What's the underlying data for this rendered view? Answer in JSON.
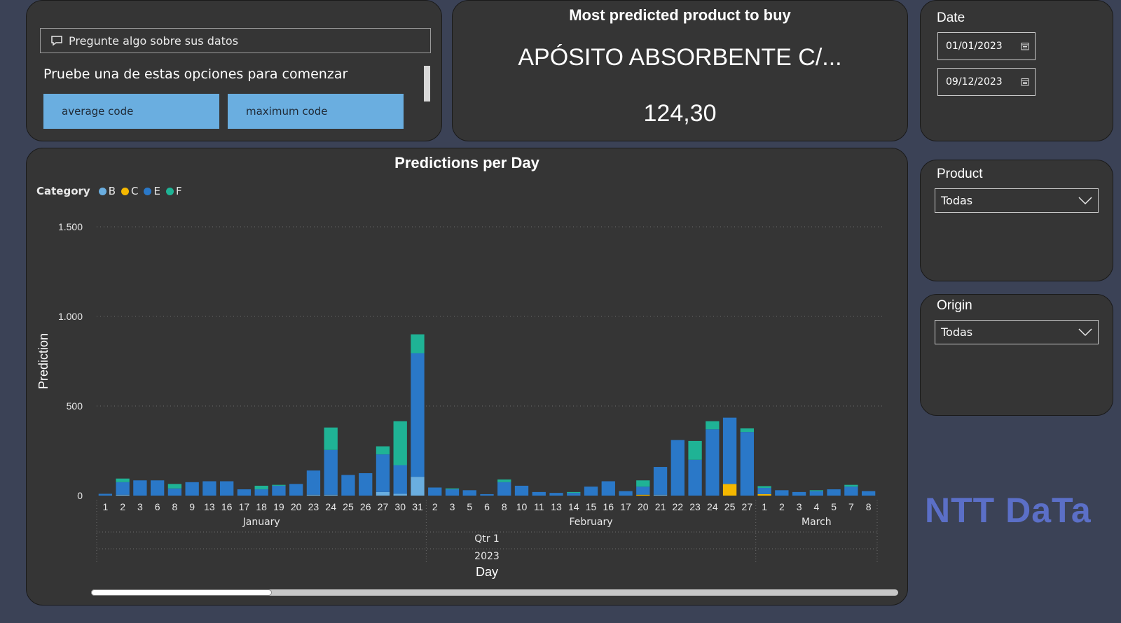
{
  "qa": {
    "placeholder": "Pregunte algo sobre sus datos",
    "prompt": "Pruebe una de estas opciones para comenzar",
    "suggestions": [
      "average code",
      "maximum code"
    ]
  },
  "kpi": {
    "title": "Most predicted product to buy",
    "product": "APÓSITO ABSORBENTE C/...",
    "value": "124,30"
  },
  "date_slicer": {
    "title": "Date",
    "start": "01/01/2023",
    "end": "09/12/2023"
  },
  "product_slicer": {
    "title": "Product",
    "value": "Todas"
  },
  "origin_slicer": {
    "title": "Origin",
    "value": "Todas"
  },
  "logo": {
    "text": "NTT DaTa"
  },
  "colors": {
    "B": "#6aaee0",
    "C": "#f5b800",
    "E": "#2a78c8",
    "F": "#1fb395"
  },
  "chart_data": {
    "type": "bar",
    "stacked": true,
    "title": "Predictions per Day",
    "ylabel": "Prediction",
    "xlabel": "Day",
    "legend_title": "Category",
    "legend_position": "top-left",
    "ylim": [
      0,
      1500
    ],
    "yticks": [
      0,
      500,
      1000,
      1500
    ],
    "ytick_labels": [
      "0",
      "500",
      "1.000",
      "1.500"
    ],
    "grid": true,
    "categories": [
      "1",
      "2",
      "3",
      "6",
      "8",
      "9",
      "13",
      "16",
      "17",
      "18",
      "19",
      "20",
      "23",
      "24",
      "25",
      "26",
      "27",
      "30",
      "31",
      "2",
      "3",
      "5",
      "6",
      "8",
      "10",
      "11",
      "13",
      "14",
      "15",
      "16",
      "17",
      "20",
      "21",
      "22",
      "23",
      "24",
      "25",
      "27",
      "1",
      "2",
      "3",
      "4",
      "5",
      "7",
      "8"
    ],
    "months": [
      {
        "label": "January",
        "start": 0,
        "end": 18
      },
      {
        "label": "February",
        "start": 19,
        "end": 37
      },
      {
        "label": "March",
        "start": 38,
        "end": 44
      }
    ],
    "quarter": "Qtr 1",
    "year": "2023",
    "series": [
      {
        "name": "B",
        "values": [
          0,
          5,
          0,
          0,
          0,
          0,
          0,
          0,
          0,
          0,
          0,
          0,
          5,
          5,
          0,
          0,
          20,
          10,
          105,
          0,
          0,
          0,
          0,
          0,
          0,
          0,
          0,
          0,
          0,
          0,
          0,
          0,
          5,
          0,
          0,
          0,
          0,
          0,
          0,
          0,
          0,
          0,
          0,
          0,
          0
        ]
      },
      {
        "name": "C",
        "values": [
          0,
          0,
          0,
          0,
          0,
          0,
          0,
          0,
          0,
          0,
          0,
          0,
          0,
          0,
          0,
          0,
          0,
          0,
          0,
          0,
          0,
          0,
          0,
          0,
          0,
          0,
          0,
          0,
          0,
          0,
          0,
          5,
          0,
          0,
          0,
          0,
          65,
          0,
          8,
          0,
          0,
          0,
          0,
          0,
          0
        ]
      },
      {
        "name": "E",
        "values": [
          10,
          70,
          85,
          85,
          40,
          75,
          80,
          80,
          35,
          35,
          55,
          65,
          135,
          250,
          115,
          125,
          210,
          160,
          690,
          45,
          35,
          30,
          8,
          75,
          55,
          20,
          15,
          15,
          50,
          80,
          25,
          45,
          155,
          310,
          200,
          370,
          370,
          355,
          35,
          30,
          20,
          25,
          35,
          50,
          25
        ]
      },
      {
        "name": "F",
        "values": [
          0,
          20,
          0,
          0,
          25,
          0,
          0,
          0,
          0,
          20,
          5,
          0,
          0,
          125,
          0,
          0,
          45,
          245,
          105,
          0,
          5,
          0,
          0,
          15,
          0,
          0,
          0,
          5,
          0,
          0,
          0,
          35,
          0,
          0,
          105,
          45,
          0,
          20,
          10,
          0,
          0,
          5,
          0,
          10,
          0
        ]
      }
    ]
  }
}
